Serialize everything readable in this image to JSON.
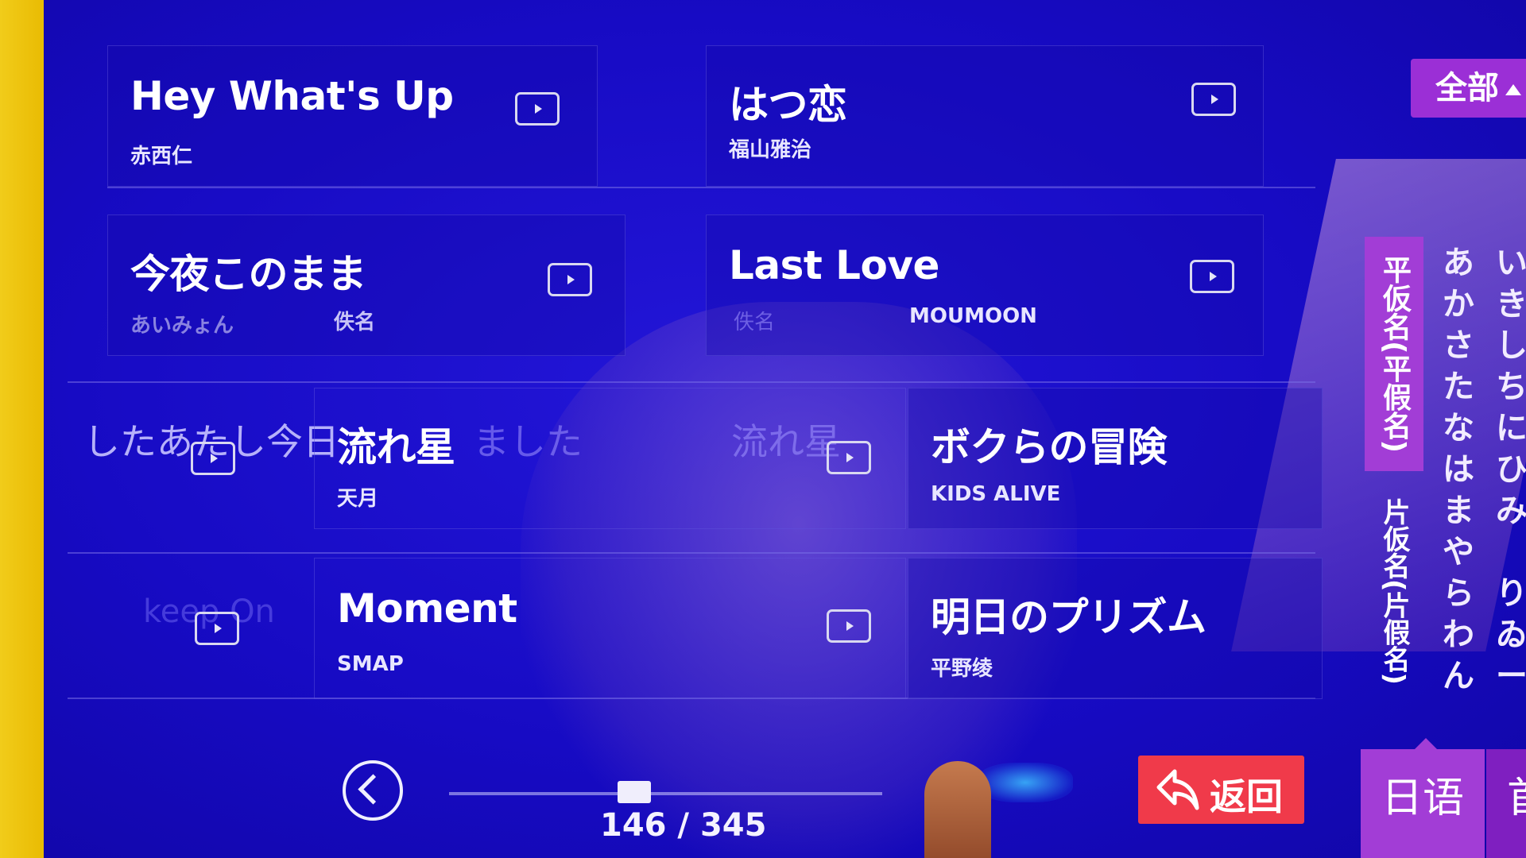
{
  "songs": [
    {
      "title": "Hey What's Up",
      "artist": "赤西仁"
    },
    {
      "title": "はつ恋",
      "artist": "福山雅治"
    },
    {
      "title": "今夜このまま",
      "artist": "あいみょん"
    },
    {
      "title": "Last Love",
      "artist": "MOUMOON"
    },
    {
      "title": "流れ星",
      "artist": "天月"
    },
    {
      "title": "ボクらの冒険",
      "artist": "KIDS ALIVE"
    },
    {
      "title": "Moment",
      "artist": "SMAP"
    },
    {
      "title": "明日のプリズム",
      "artist": "平野绫"
    }
  ],
  "ghost": {
    "artist_label_a": "佚名",
    "artist_label_b": "佚名",
    "line_left": "したあたし今日",
    "line_mid": "ました",
    "line_right": "流れ星",
    "keep_on": "keep On"
  },
  "filter": {
    "all_label": "全部"
  },
  "kana": {
    "hiragana_tab": "平仮名(平假名)",
    "katakana_tab": "片仮名(片假名)",
    "col1": [
      "あ",
      "か",
      "さ",
      "た",
      "な",
      "は",
      "ま",
      "や",
      "ら",
      "わ",
      "ん"
    ],
    "col2": [
      "い",
      "き",
      "し",
      "ち",
      "に",
      "ひ",
      "み",
      "",
      "り",
      "ゐ",
      "ー"
    ]
  },
  "pager": {
    "indicator": "146 / 345",
    "current": 146,
    "total": 345
  },
  "buttons": {
    "return_label": "返回"
  },
  "bottom_tabs": {
    "japanese": "日语",
    "first": "首拼"
  },
  "colors": {
    "accent": "#a23dd6",
    "return": "#f03a4a",
    "background": "#170bc4"
  }
}
